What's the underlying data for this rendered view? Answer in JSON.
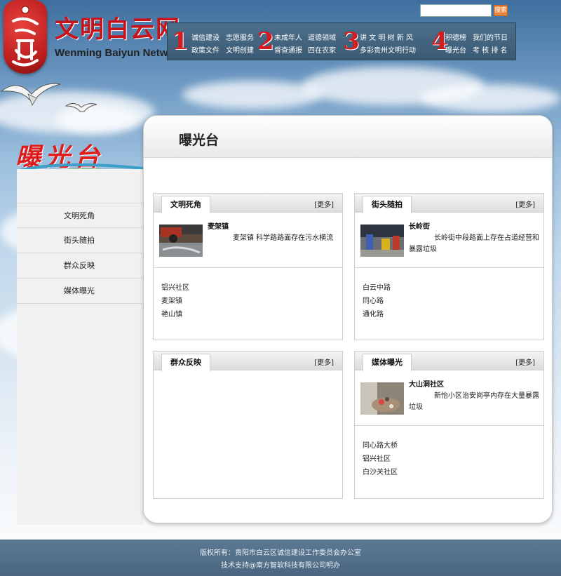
{
  "header": {
    "logo_alt": "文明白云网 logo",
    "site_title": "文明白云网",
    "site_subtitle": "Wenming Baiyun Network",
    "search": {
      "value": "",
      "placeholder": "",
      "button_label": "搜索"
    },
    "nav_groups": [
      {
        "num": "1",
        "links": [
          "诚信建设",
          "志愿服务",
          "政策文件",
          "文明创建"
        ]
      },
      {
        "num": "2",
        "links": [
          "未成年人",
          "道德领域",
          "督查通报",
          "四在农家"
        ]
      },
      {
        "num": "3",
        "links": [
          "讲 文 明 树 新 风",
          "多彩贵州文明行动"
        ]
      },
      {
        "num": "4",
        "links": [
          "积德榜",
          "我们的节日",
          "曝光台",
          "考 核 排 名"
        ]
      }
    ]
  },
  "sidebar": {
    "title": "曝光台",
    "items": [
      {
        "label": "文明死角"
      },
      {
        "label": "街头随拍"
      },
      {
        "label": "群众反映"
      },
      {
        "label": "媒体曝光"
      }
    ]
  },
  "main": {
    "title": "曝光台",
    "boxes": [
      {
        "tab": "文明死角",
        "more": "[更多]",
        "featured": {
          "title": "麦架镇",
          "desc": "麦架镇 科学路路面存在污水横流"
        },
        "list": [
          "铝兴社区",
          "麦架镇",
          "艳山镇"
        ]
      },
      {
        "tab": "街头随拍",
        "more": "[更多]",
        "featured": {
          "title": "长岭街",
          "desc": "长岭街中段路面上存在占道经营和暴露垃圾"
        },
        "list": [
          "白云中路",
          "同心路",
          "通化路"
        ]
      },
      {
        "tab": "群众反映",
        "more": "[更多]",
        "featured": null,
        "list": []
      },
      {
        "tab": "媒体曝光",
        "more": "[更多]",
        "featured": {
          "title": "大山洞社区",
          "desc": "新怡小区治安岗亭内存在大量暴露垃圾"
        },
        "list": [
          "同心路大桥",
          "铝兴社区",
          "白沙关社区"
        ]
      }
    ]
  },
  "footer": {
    "copyright": "版权所有：贵阳市白云区诚信建设工作委员会办公室",
    "support": "技术支持@南方智软科技有限公司明办"
  },
  "colors": {
    "brand_red": "#c6141a",
    "nav_bg": "#45657f",
    "footer_bg": "#52708a",
    "search_button": "#e7833a"
  },
  "icons": [
    "seagull-icon",
    "logo-seal-icon"
  ]
}
